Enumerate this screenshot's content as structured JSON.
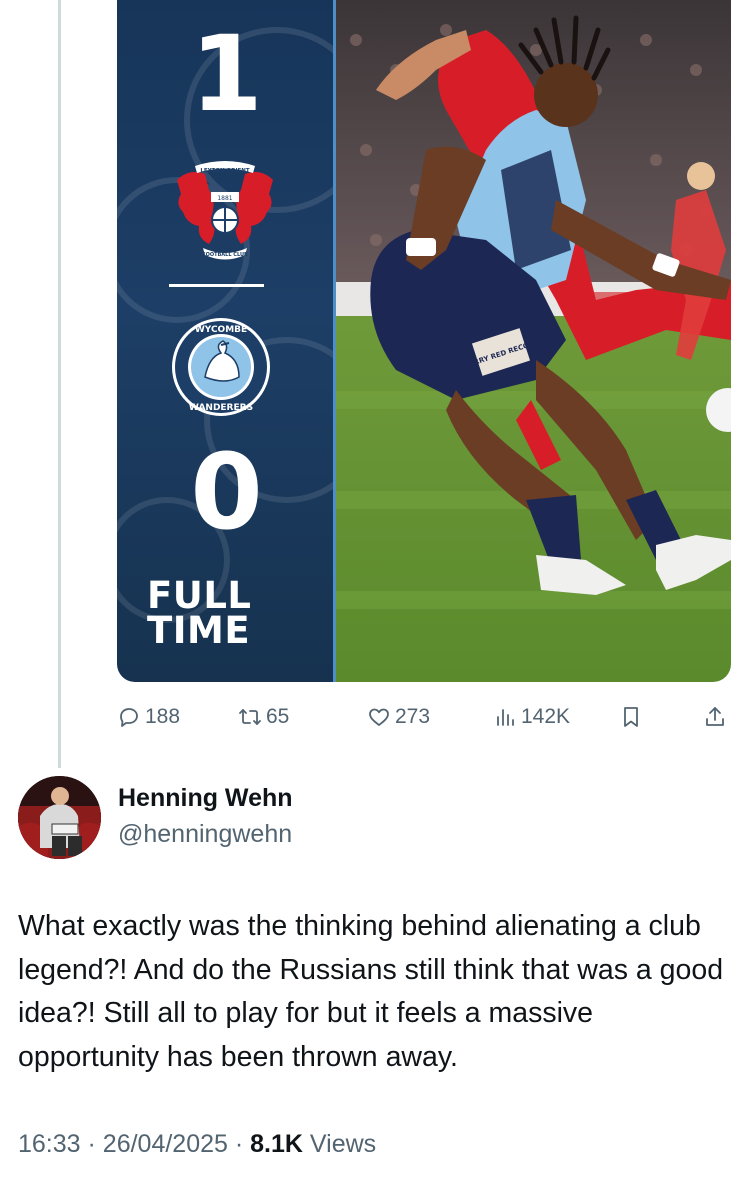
{
  "media": {
    "home_score": "1",
    "away_score": "0",
    "home_crest_text_top": "LEYTON ORIENT",
    "home_crest_text_bottom": "FOOTBALL CLUB",
    "home_crest_year": "1881",
    "away_crest_text_top": "WYCOMBE",
    "away_crest_text_bottom": "WANDERERS",
    "status_line1": "FULL",
    "status_line2": "TIME",
    "shorts_sponsor": "CHERRY RED RECORDS",
    "colors": {
      "panel": "#173559",
      "panel_edge": "#4f8fc8",
      "home_red": "#d71e28",
      "away_blue": "#8fc3e8"
    }
  },
  "actions": {
    "reply_count": "188",
    "retweet_count": "65",
    "like_count": "273",
    "views_count": "142K",
    "icons": [
      "reply-icon",
      "retweet-icon",
      "like-icon",
      "views-icon",
      "bookmark-icon",
      "share-icon"
    ]
  },
  "author": {
    "name": "Henning Wehn",
    "handle": "@henningwehn"
  },
  "tweet": {
    "text": "What exactly was the thinking behind alienating a club legend?! And do the Russians still think that was a good idea?! Still all to play for but it feels a massive opportunity has been thrown away."
  },
  "meta": {
    "time": "16:33",
    "separator": "·",
    "date": "26/04/2025",
    "views_count": "8.1K",
    "views_label": "Views"
  }
}
